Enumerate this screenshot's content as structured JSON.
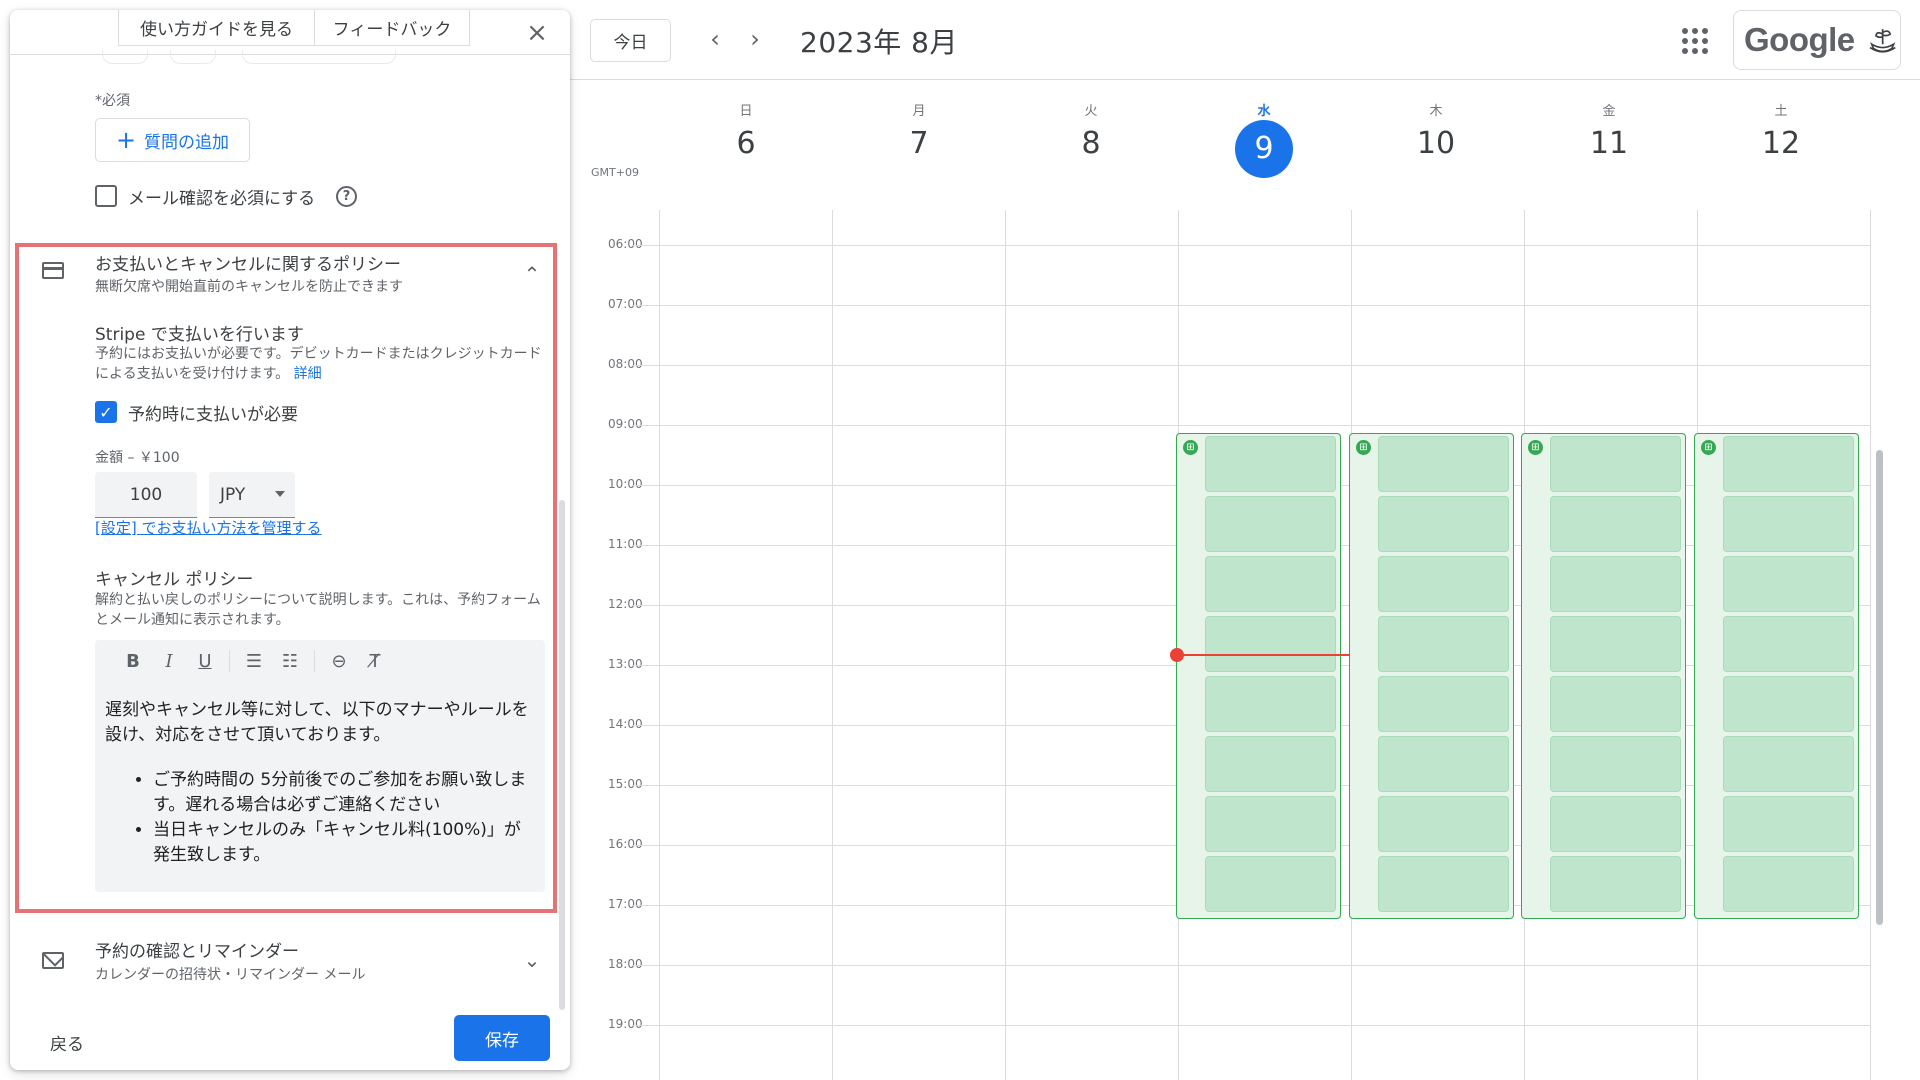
{
  "panel": {
    "guide_tab": "使い方ガイドを見る",
    "feedback_tab": "フィードバック",
    "close_icon": "×",
    "required_note": "*必須",
    "add_question": "質問の追加",
    "email_verify_label": "メール確認を必須にする",
    "email_verify_checked": false,
    "payment_section": {
      "title": "お支払いとキャンセルに関するポリシー",
      "subtitle": "無断欠席や開始直前のキャンセルを防止できます",
      "stripe_title": "Stripe で支払いを行います",
      "stripe_desc": "予約にはお支払いが必要です。デビットカードまたはクレジットカードによる支払いを受け付けます。",
      "details_link": "詳細",
      "require_payment_label": "予約時に支払いが必要",
      "require_payment_checked": true,
      "amount_label": "金額 – ￥100",
      "amount_value": "100",
      "currency": "JPY",
      "settings_link": "[設定] でお支払い方法を管理する",
      "cancel_title": "キャンセル ポリシー",
      "cancel_desc": "解約と払い戻しのポリシーについて説明します。これは、予約フォームとメール通知に表示されます。",
      "editor_text": "遅刻やキャンセル等に対して、以下のマナーやルールを設け、対応をさせて頂いております。",
      "editor_bullets": [
        "ご予約時間の 5分前後でのご参加をお願い致します。遅れる場合は必ずご連絡ください",
        "当日キャンセルのみ「キャンセル料(100%)」が発生致します。"
      ]
    },
    "reminder_section": {
      "title": "予約の確認とリマインダー",
      "subtitle": "カレンダーの招待状・リマインダー メール"
    },
    "back_button": "戻る",
    "save_button": "保存"
  },
  "calendar": {
    "today_button": "今日",
    "month_title": "2023年 8月",
    "brand": "Google",
    "timezone": "GMT+09",
    "days": [
      {
        "dow": "日",
        "num": "6"
      },
      {
        "dow": "月",
        "num": "7"
      },
      {
        "dow": "火",
        "num": "8"
      },
      {
        "dow": "水",
        "num": "9",
        "today": true
      },
      {
        "dow": "木",
        "num": "10"
      },
      {
        "dow": "金",
        "num": "11"
      },
      {
        "dow": "土",
        "num": "12"
      }
    ],
    "hours": [
      "06:00",
      "07:00",
      "08:00",
      "09:00",
      "10:00",
      "11:00",
      "12:00",
      "13:00",
      "14:00",
      "15:00",
      "16:00",
      "17:00",
      "18:00",
      "19:00"
    ],
    "accent_color": "#1a73e8",
    "slot_color": "#34a853",
    "now_color": "#ea4335"
  }
}
